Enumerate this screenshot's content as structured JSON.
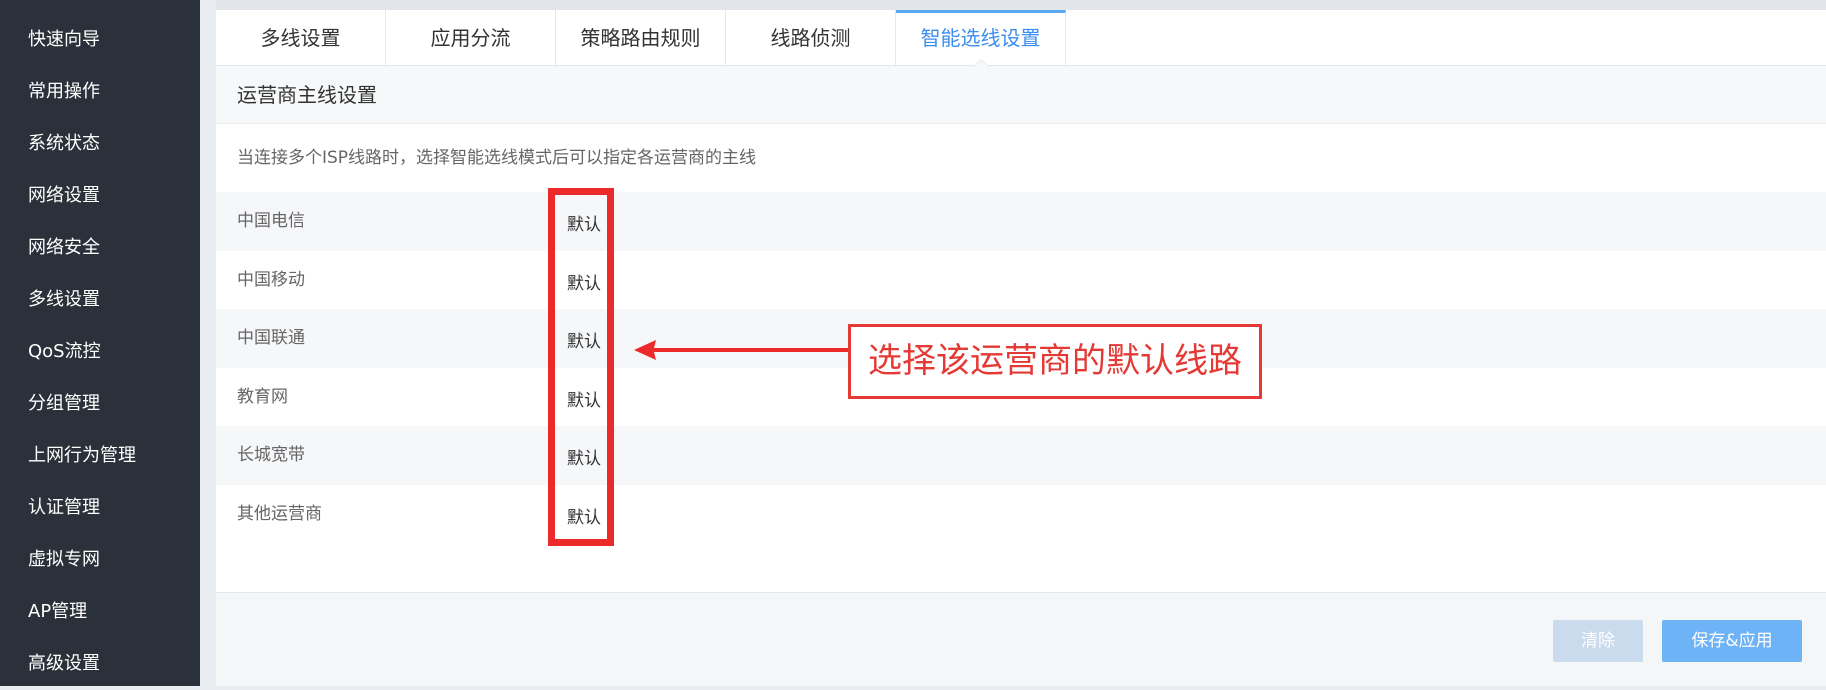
{
  "sidebar": {
    "items": [
      {
        "label": "快速向导"
      },
      {
        "label": "常用操作"
      },
      {
        "label": "系统状态"
      },
      {
        "label": "网络设置"
      },
      {
        "label": "网络安全"
      },
      {
        "label": "多线设置"
      },
      {
        "label": "QoS流控"
      },
      {
        "label": "分组管理"
      },
      {
        "label": "上网行为管理"
      },
      {
        "label": "认证管理"
      },
      {
        "label": "虚拟专网"
      },
      {
        "label": "AP管理"
      },
      {
        "label": "高级设置"
      }
    ]
  },
  "tabs": [
    {
      "label": "多线设置",
      "active": false
    },
    {
      "label": "应用分流",
      "active": false
    },
    {
      "label": "策略路由规则",
      "active": false
    },
    {
      "label": "线路侦测",
      "active": false
    },
    {
      "label": "智能选线设置",
      "active": true
    }
  ],
  "section": {
    "title": "运营商主线设置",
    "description": "当连接多个ISP线路时，选择智能选线模式后可以指定各运营商的主线",
    "rows": [
      {
        "label": "中国电信",
        "value": "默认"
      },
      {
        "label": "中国移动",
        "value": "默认"
      },
      {
        "label": "中国联通",
        "value": "默认"
      },
      {
        "label": "教育网",
        "value": "默认"
      },
      {
        "label": "长城宽带",
        "value": "默认"
      },
      {
        "label": "其他运营商",
        "value": "默认"
      }
    ]
  },
  "annotation": {
    "callout_text": "选择该运营商的默认线路",
    "color": "#e53935"
  },
  "footer": {
    "clear_label": "清除",
    "save_label": "保存&应用"
  },
  "colors": {
    "sidebar_bg": "#2b313a",
    "active_tab": "#3b8ef0",
    "save_button": "#6db3f5",
    "clear_button": "#cbdbee"
  }
}
